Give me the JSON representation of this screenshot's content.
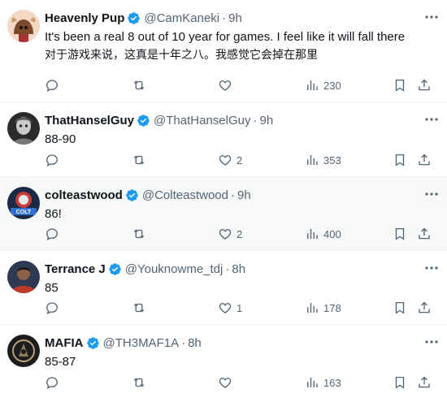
{
  "colors": {
    "text": "#0f1419",
    "muted": "#536471",
    "verified": "#1d9bf0",
    "highlight_bg": "#f7f9f9"
  },
  "tweets": [
    {
      "name": "Heavenly Pup",
      "handle": "@CamKaneki",
      "time": "9h",
      "text_lines": [
        "It's been a real 8 out of 10 year for games. I feel like it will fall there",
        "对于游戏来说，这真是十年之八。我感觉它会掉在那里"
      ],
      "replies": "",
      "retweets": "",
      "likes": "",
      "views": "230",
      "avatar_icon": "goat-avatar-icon"
    },
    {
      "name": "ThatHanselGuy",
      "handle": "@ThatHanselGuy",
      "time": "9h",
      "text_lines": [
        "88-90"
      ],
      "replies": "",
      "retweets": "",
      "likes": "2",
      "views": "353",
      "avatar_icon": "portrait-avatar-icon"
    },
    {
      "name": "colteastwood",
      "handle": "@Colteastwood",
      "time": "9h",
      "text_lines": [
        "86!"
      ],
      "replies": "",
      "retweets": "",
      "likes": "2",
      "views": "400",
      "avatar_icon": "colt-logo-avatar-icon",
      "avatar_text": "COLT"
    },
    {
      "name": "Terrance J",
      "handle": "@Youknowme_tdj",
      "time": "8h",
      "text_lines": [
        "85"
      ],
      "replies": "",
      "retweets": "",
      "likes": "1",
      "views": "178",
      "avatar_icon": "person-avatar-icon"
    },
    {
      "name": "MAFIA",
      "handle": "@TH3MAF1A",
      "time": "8h",
      "text_lines": [
        "85-87"
      ],
      "replies": "",
      "retweets": "",
      "likes": "",
      "views": "163",
      "avatar_icon": "emblem-avatar-icon"
    }
  ]
}
